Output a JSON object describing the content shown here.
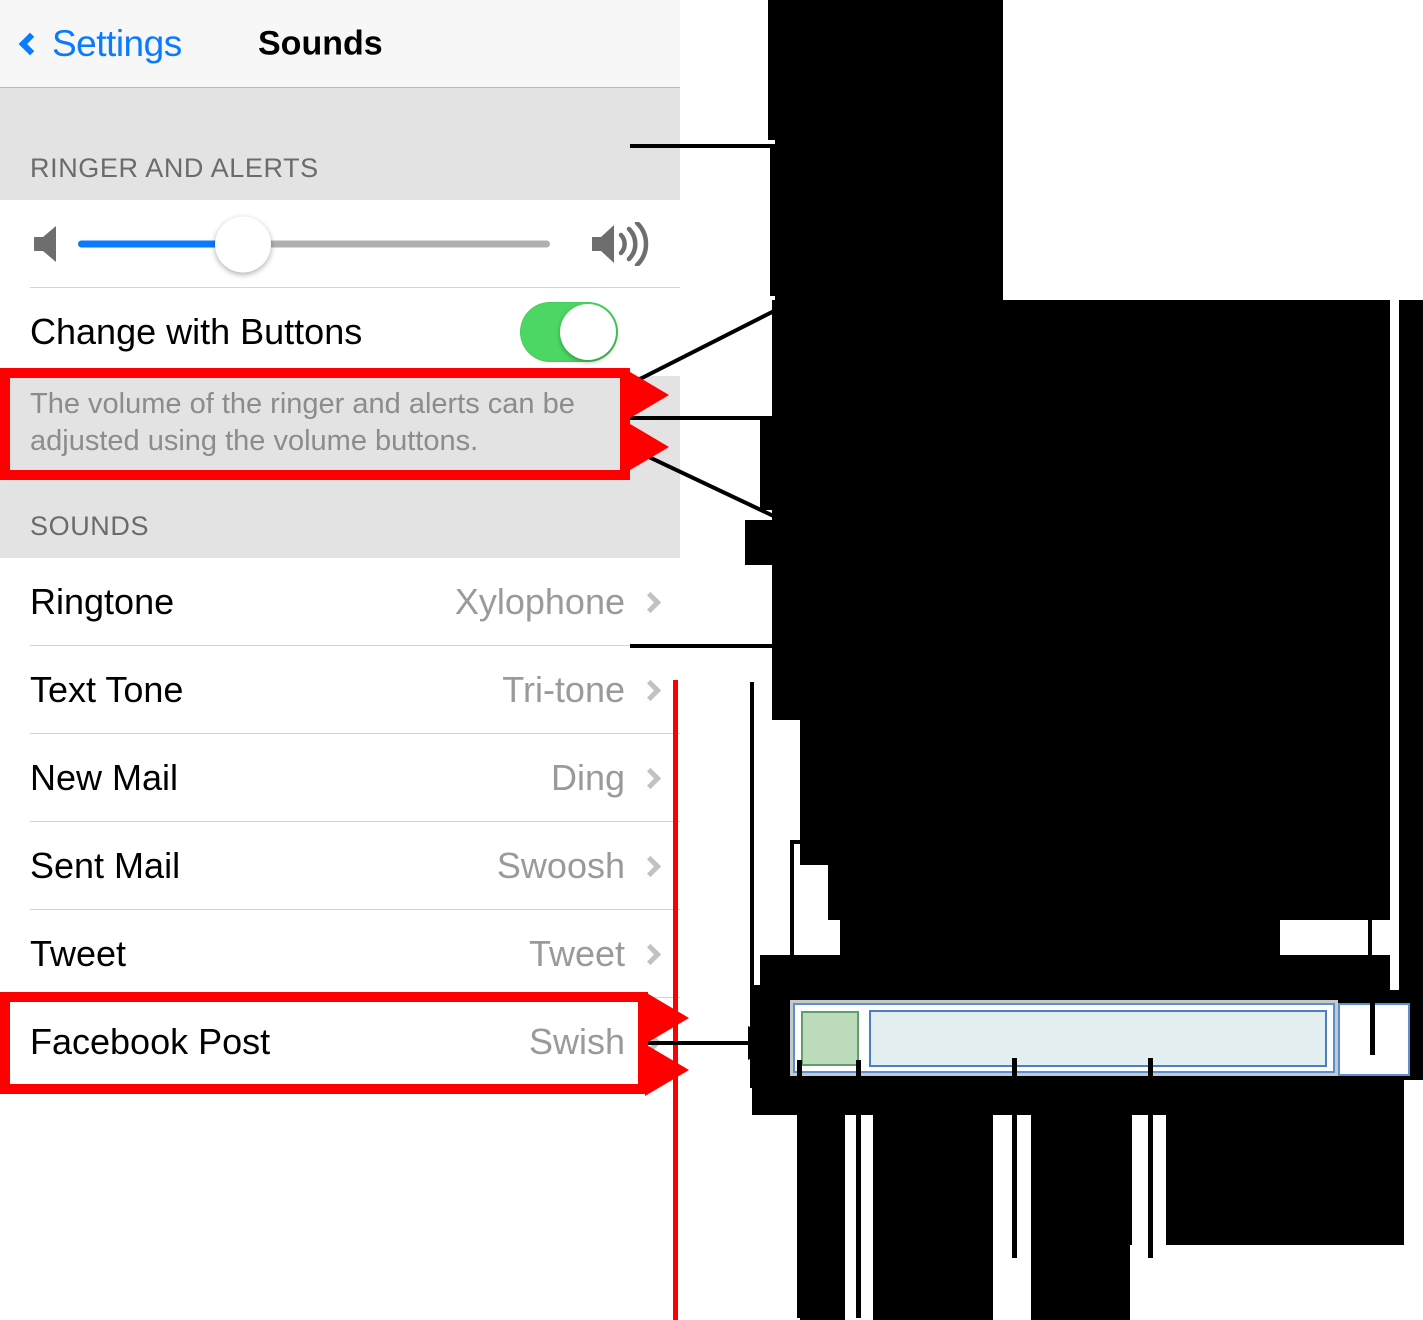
{
  "nav": {
    "back_label": "Settings",
    "title": "Sounds",
    "back_icon": "chevron-left-icon",
    "accent_color": "#0a7bff"
  },
  "sections": {
    "ringer_header": "RINGER AND ALERTS",
    "sounds_header": "SOUNDS"
  },
  "volume": {
    "min_icon": "speaker-low-icon",
    "max_icon": "speaker-high-icon",
    "fill_percent": 35,
    "fill_color": "#0a7bff"
  },
  "change_with_buttons": {
    "label": "Change with Buttons",
    "state": "on",
    "on_color": "#4cd663"
  },
  "note": {
    "text": "The volume of the ringer and alerts can be adjusted using the volume buttons."
  },
  "sound_rows": [
    {
      "label": "Ringtone",
      "value": "Xylophone",
      "chevron": "chevron-right-icon"
    },
    {
      "label": "Text Tone",
      "value": "Tri-tone",
      "chevron": "chevron-right-icon"
    },
    {
      "label": "New Mail",
      "value": "Ding",
      "chevron": "chevron-right-icon"
    },
    {
      "label": "Sent Mail",
      "value": "Swoosh",
      "chevron": "chevron-right-icon"
    },
    {
      "label": "Tweet",
      "value": "Tweet",
      "chevron": "chevron-right-icon"
    },
    {
      "label": "Facebook Post",
      "value": "Swish",
      "chevron": "chevron-right-icon"
    }
  ],
  "annotations": {
    "highlight_color": "#ff0000",
    "leader_color": "#000000",
    "highlighted_items": [
      "note",
      "facebook-post-row"
    ]
  },
  "widget": {
    "green_swatch_color": "#bcdcbc",
    "input_field_color": "#e3eef0",
    "white_box_color": "#ffffff",
    "frame_color": "#c8c8c8",
    "border_color": "#5b8fd0"
  },
  "redaction": {
    "color": "#000000",
    "note": "right side content obscured"
  }
}
